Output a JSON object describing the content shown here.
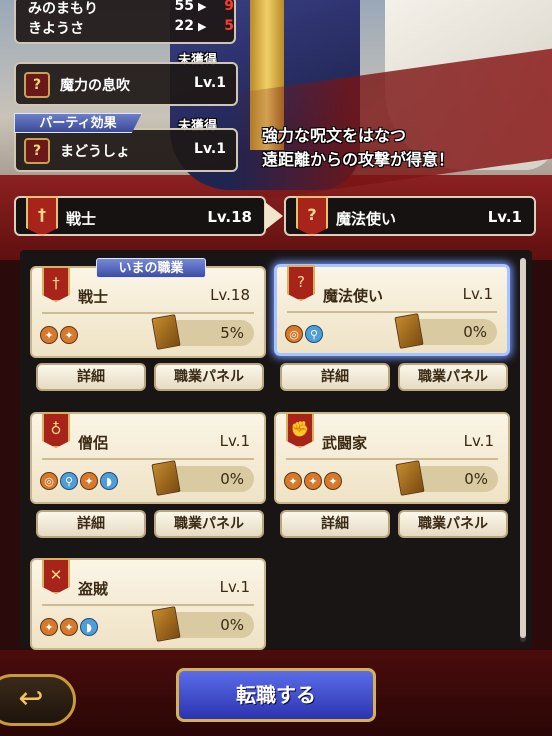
{
  "stats": [
    {
      "name": "みのまもり",
      "value": "55",
      "new_value": "9"
    },
    {
      "name": "きようさ",
      "value": "22",
      "new_value": "5"
    }
  ],
  "skills": [
    {
      "status": "未獲得",
      "name": "魔力の息吹",
      "level": "Lv.1",
      "icon": "?"
    },
    {
      "status": "未獲得",
      "name": "まどうしょ",
      "level": "Lv.1",
      "icon": "?",
      "tag": "パーティ効果"
    }
  ],
  "flavor_text": [
    "強力な呪文をはなつ",
    "遠距離からの攻撃が得意！"
  ],
  "selector": {
    "current": {
      "name": "戦士",
      "level": "Lv.18"
    },
    "target": {
      "name": "魔法使い",
      "level": "Lv.1"
    }
  },
  "current_job_label": "いまの職業",
  "jobs": [
    {
      "name": "戦士",
      "level": "Lv.18",
      "progress": "5%",
      "badge_icon": "sword-icon",
      "weapons": [
        "o",
        "o"
      ]
    },
    {
      "name": "魔法使い",
      "level": "Lv.1",
      "progress": "0%",
      "badge_icon": "question-icon",
      "weapons": [
        "o",
        "b"
      ],
      "selected": true
    },
    {
      "name": "僧侶",
      "level": "Lv.1",
      "progress": "0%",
      "badge_icon": "staff-icon",
      "weapons": [
        "o",
        "b",
        "o",
        "b"
      ]
    },
    {
      "name": "武闘家",
      "level": "Lv.1",
      "progress": "0%",
      "badge_icon": "fist-icon",
      "weapons": [
        "o",
        "o",
        "o"
      ]
    },
    {
      "name": "盗賊",
      "level": "Lv.1",
      "progress": "0%",
      "badge_icon": "crossed-daggers-icon",
      "weapons": [
        "o",
        "o",
        "b"
      ]
    }
  ],
  "buttons": {
    "detail": "詳細",
    "job_panel": "職業パネル",
    "change_job": "転職する",
    "back_icon": "back-arrow-icon"
  },
  "colors": {
    "accent_red": "#a8241a",
    "selected_glow": "#6d94ff",
    "stat_up": "#ff3a2a",
    "change_button": "#3c4ac8"
  }
}
